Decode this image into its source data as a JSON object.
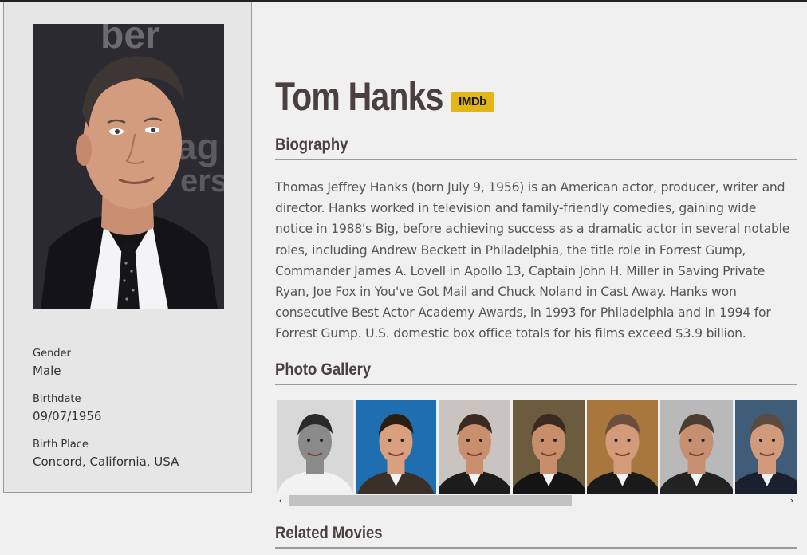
{
  "profile": {
    "name": "Tom Hanks",
    "imdb_badge": "IMDb",
    "portrait_alt": "Tom Hanks portrait",
    "gender_label": "Gender",
    "gender": "Male",
    "birthdate_label": "Birthdate",
    "birthdate": "09/07/1956",
    "birthplace_label": "Birth Place",
    "birthplace": "Concord, California, USA"
  },
  "sections": {
    "biography_title": "Biography",
    "gallery_title": "Photo Gallery",
    "related_title": "Related Movies"
  },
  "biography": "Thomas Jeffrey Hanks (born July 9, 1956) is an American actor, producer, writer and director. Hanks worked in television and family-friendly comedies, gaining wide notice in 1988's Big, before achieving success as a dramatic actor in several notable roles, including Andrew Beckett in Philadelphia, the title role in Forrest Gump, Commander James A. Lovell in Apollo 13, Captain John H. Miller in Saving Private Ryan, Joe Fox in You've Got Mail and Chuck Noland in Cast Away. Hanks won consecutive Best Actor Academy Awards, in 1993 for Philadelphia and in 1994 for Forrest Gump. U.S. domestic box office totals for his films exceed $3.9 billion.",
  "gallery": {
    "scroll_left": "‹",
    "scroll_right": "›",
    "scroll_position": 0.0,
    "photos": [
      {
        "bg": "#d8d8d8",
        "suit": "#f2f2f2",
        "skin": "#8a8a8a",
        "hair": "#2a2a2a"
      },
      {
        "bg": "#1f6fb0",
        "suit": "#3b2f2a",
        "skin": "#d9a07f",
        "hair": "#2b1d14"
      },
      {
        "bg": "#c9c4bf",
        "suit": "#1c1c1c",
        "skin": "#c98f6f",
        "hair": "#3a2a22"
      },
      {
        "bg": "#6a5c3c",
        "suit": "#141414",
        "skin": "#c88e6c",
        "hair": "#3a2a22"
      },
      {
        "bg": "#a8773d",
        "suit": "#1a1a1a",
        "skin": "#d39b7a",
        "hair": "#6a4f3f"
      },
      {
        "bg": "#b9b9b9",
        "suit": "#222222",
        "skin": "#c68f72",
        "hair": "#4a3b33"
      },
      {
        "bg": "#3f5d78",
        "suit": "#1b2030",
        "skin": "#d19a7b",
        "hair": "#5a4a3f"
      }
    ]
  }
}
